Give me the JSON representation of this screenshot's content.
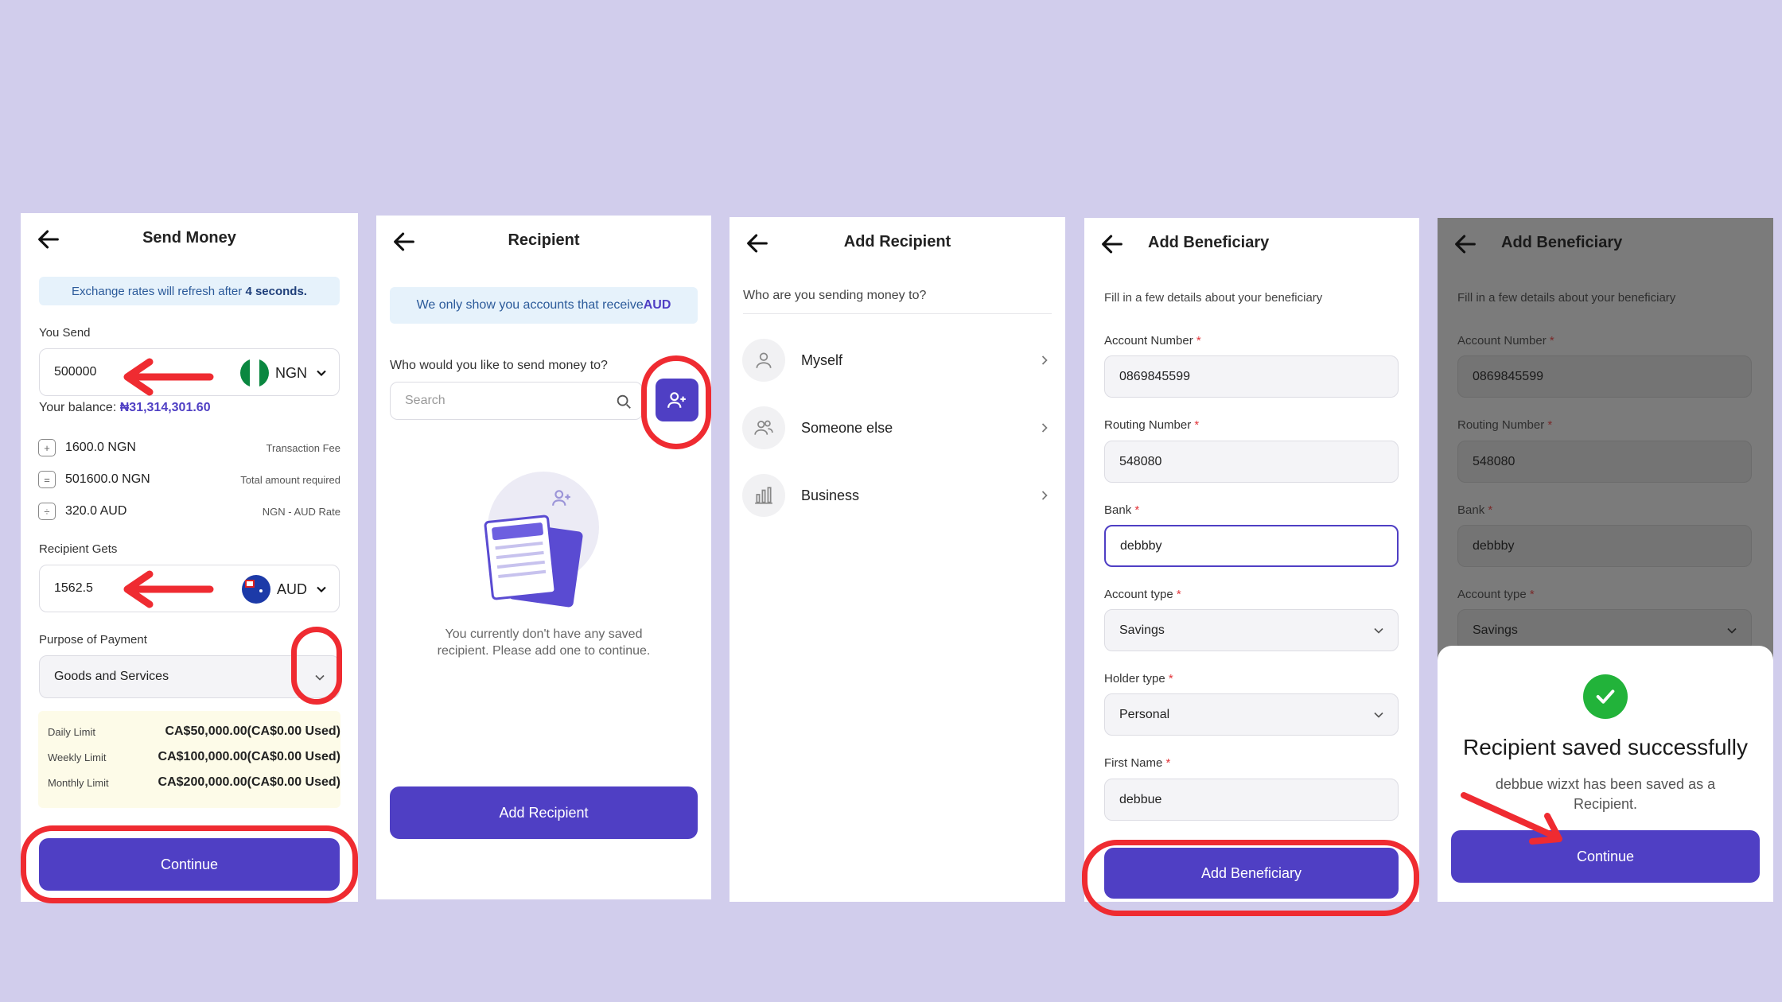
{
  "colors": {
    "accent": "#4f3fc4",
    "annotation": "#ef2b31",
    "success": "#22b33a"
  },
  "s1": {
    "title": "Send Money",
    "banner_pre": "Exchange rates will refresh after ",
    "banner_bold": "4 seconds.",
    "you_send_label": "You Send",
    "you_send_value": "500000",
    "send_currency": "NGN",
    "balance_label": "Your balance: ",
    "balance_value": "₦31,314,301.60",
    "fees": [
      {
        "icon": "+",
        "value": "1600.0 NGN",
        "desc": "Transaction Fee"
      },
      {
        "icon": "=",
        "value": "501600.0 NGN",
        "desc": "Total amount required"
      },
      {
        "icon": "÷",
        "value": "320.0 AUD",
        "desc": "NGN - AUD Rate"
      }
    ],
    "recipient_gets_label": "Recipient Gets",
    "recipient_gets_value": "1562.5",
    "recv_currency": "AUD",
    "purpose_label": "Purpose of Payment",
    "purpose_value": "Goods and Services",
    "limits": [
      {
        "k": "Daily Limit",
        "v": "CA$50,000.00(CA$0.00 Used)"
      },
      {
        "k": "Weekly Limit",
        "v": "CA$100,000.00(CA$0.00 Used)"
      },
      {
        "k": "Monthly Limit",
        "v": "CA$200,000.00(CA$0.00 Used)"
      }
    ],
    "continue": "Continue"
  },
  "s2": {
    "title": "Recipient",
    "banner_pre": "We only show you accounts that receive ",
    "banner_bold": "AUD",
    "question": "Who would you like to send money to?",
    "search_placeholder": "Search",
    "empty_line1": "You currently don't have any saved",
    "empty_line2": "recipient. Please add one to continue.",
    "add_button": "Add Recipient"
  },
  "s3": {
    "title": "Add Recipient",
    "question": "Who are you sending money to?",
    "options": [
      {
        "label": "Myself",
        "icon": "user-icon"
      },
      {
        "label": "Someone else",
        "icon": "users-icon"
      },
      {
        "label": "Business",
        "icon": "chart-icon"
      }
    ]
  },
  "s4": {
    "title": "Add Beneficiary",
    "subtitle": "Fill in a few details about your beneficiary",
    "fields": {
      "account_label": "Account Number",
      "account_value": "0869845599",
      "routing_label": "Routing Number",
      "routing_value": "548080",
      "bank_label": "Bank",
      "bank_value": "debbby",
      "account_type_label": "Account type",
      "account_type_value": "Savings",
      "holder_label": "Holder type",
      "holder_value": "Personal",
      "first_name_label": "First Name",
      "first_name_value": "debbue"
    },
    "star": "*",
    "button": "Add Beneficiary"
  },
  "s5": {
    "title": "Add Beneficiary",
    "subtitle": "Fill in a few details about your beneficiary",
    "modal_title": "Recipient saved successfully",
    "modal_line1": "debbue wizxt has been saved as a",
    "modal_line2": "Recipient.",
    "continue": "Continue"
  }
}
